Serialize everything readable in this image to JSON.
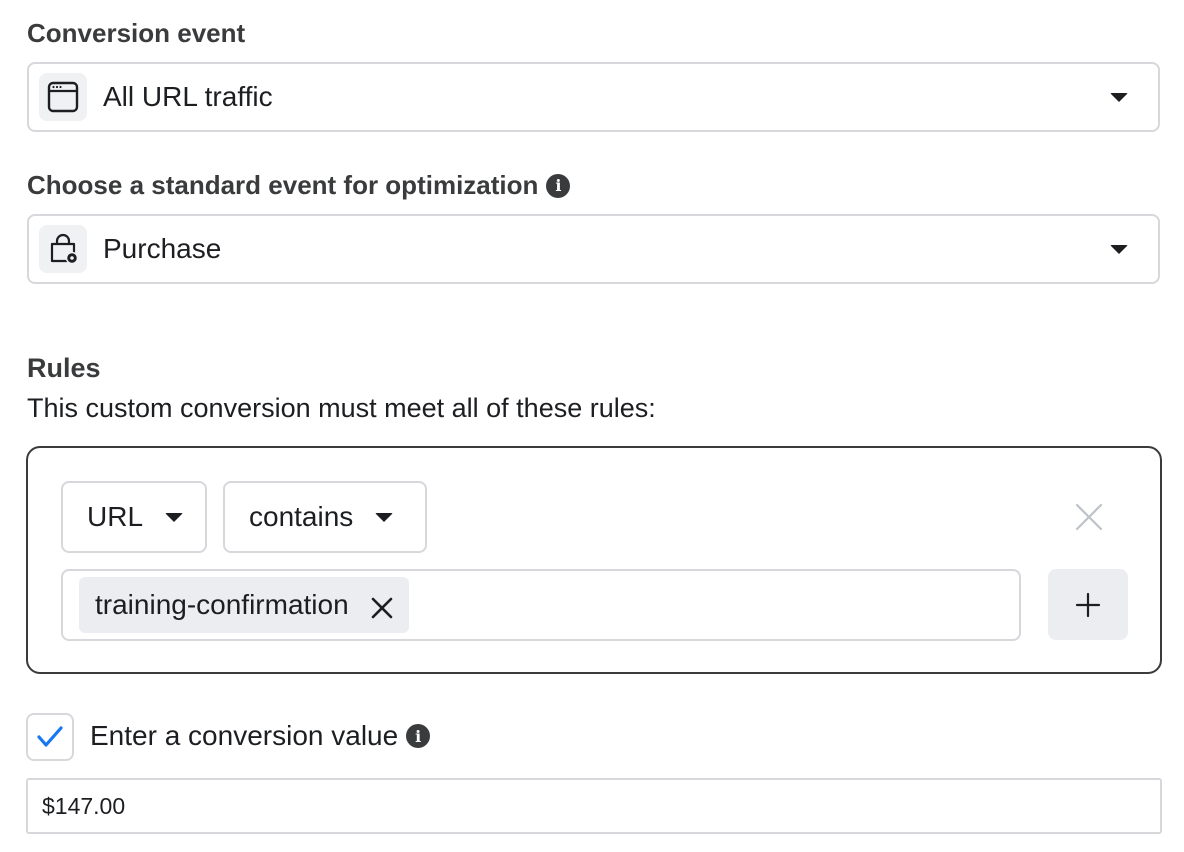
{
  "conversion_event": {
    "label": "Conversion event",
    "value": "All URL traffic",
    "icon": "browser-window-icon"
  },
  "standard_event": {
    "label": "Choose a standard event for optimization",
    "value": "Purchase",
    "icon": "shopping-bag-icon"
  },
  "rules": {
    "title": "Rules",
    "description": "This custom conversion must meet all of these rules:",
    "field_select": "URL",
    "operator_select": "contains",
    "tags": [
      "training-confirmation"
    ]
  },
  "conversion_value": {
    "checkbox_label": "Enter a conversion value",
    "checked": true,
    "value": "$147.00"
  },
  "colors": {
    "border": "#d6d8dc",
    "check": "#1877f2",
    "text": "#1c1e21",
    "label": "#3a3b3c"
  }
}
